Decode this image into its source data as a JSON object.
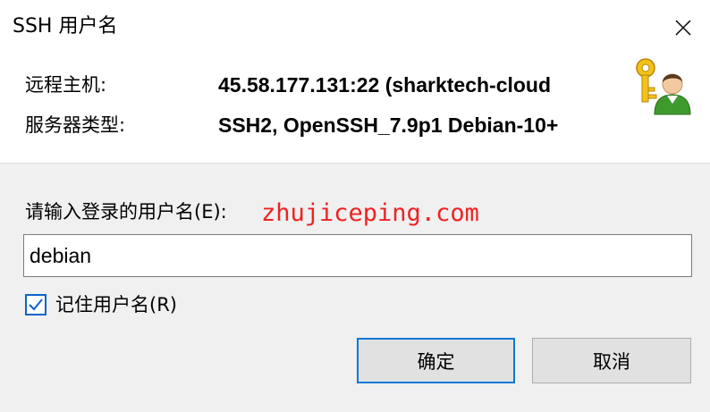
{
  "window": {
    "title": "SSH 用户名",
    "close_icon": "close-icon"
  },
  "info": {
    "remote_host_label": "远程主机:",
    "remote_host_value": "45.58.177.131:22 (sharktech-cloud",
    "server_type_label": "服务器类型:",
    "server_type_value": "SSH2, OpenSSH_7.9p1 Debian-10+",
    "avatar_icon": "user-key-icon"
  },
  "login": {
    "prompt_label": "请输入登录的用户名(E):",
    "watermark": "zhujiceping.com",
    "watermark_color": "#ee2222",
    "username_value": "debian",
    "remember_label": "记住用户名(R)",
    "remember_checked": true
  },
  "buttons": {
    "ok_label": "确定",
    "cancel_label": "取消"
  },
  "colors": {
    "accent": "#0a78d7",
    "lower_background": "#f0f0f0"
  }
}
